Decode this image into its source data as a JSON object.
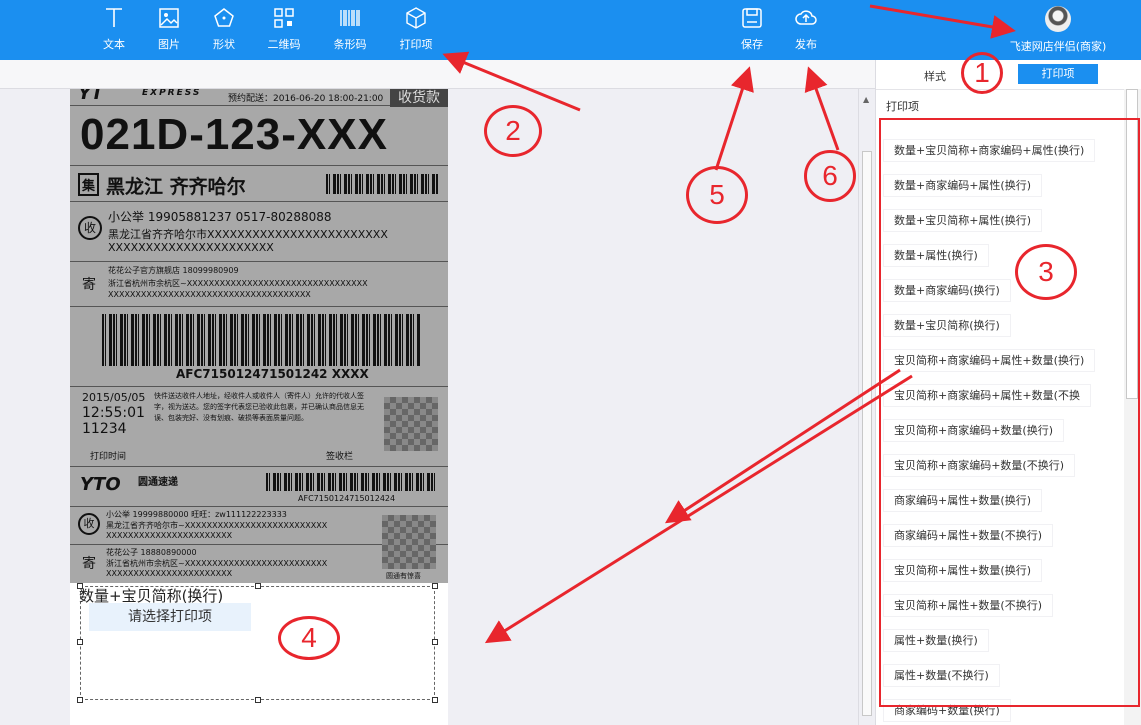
{
  "toolbar": {
    "tools": [
      "文本",
      "图片",
      "形状",
      "二维码",
      "条形码",
      "打印项"
    ],
    "save": "保存",
    "publish": "发布",
    "user_name": "飞速网店伴侣(商家)"
  },
  "right_panel": {
    "tab_style": "样式",
    "tab_print": "打印项",
    "section_title": "打印项",
    "items": [
      "数量+宝贝简称+商家编码+属性(换行)",
      "数量+商家编码+属性(换行)",
      "数量+宝贝简称+属性(换行)",
      "数量+属性(换行)",
      "数量+商家编码(换行)",
      "数量+宝贝简称(换行)",
      "宝贝简称+商家编码+属性+数量(换行)",
      "宝贝简称+商家编码+属性+数量(不换",
      "宝贝简称+商家编码+数量(换行)",
      "宝贝简称+商家编码+数量(不换行)",
      "商家编码+属性+数量(换行)",
      "商家编码+属性+数量(不换行)",
      "宝贝简称+属性+数量(换行)",
      "宝贝简称+属性+数量(不换行)",
      "属性+数量(换行)",
      "属性+数量(不换行)",
      "商家编码+数量(换行)"
    ]
  },
  "label": {
    "express_en": "EXPRESS",
    "schedule": "预约配送：2016-06-20 18:00-21:00",
    "receipt_tag": "收货款",
    "big_code": "021D-123-XXX",
    "ji": "集",
    "region": "黑龙江 齐齐哈尔",
    "shou": "收",
    "receiver_line": "小公举   19905881237   0517-80288088",
    "receiver_addr1": "黑龙江省齐齐哈尔市XXXXXXXXXXXXXXXXXXXXXXXX",
    "receiver_addr2": "XXXXXXXXXXXXXXXXXXXXXX",
    "ji2": "寄",
    "sender_line": "花花公子官方旗舰店   18099980909",
    "sender_addr1": "浙江省杭州市余杭区~XXXXXXXXXXXXXXXXXXXXXXXXXXXXXXXXX",
    "sender_addr2": "XXXXXXXXXXXXXXXXXXXXXXXXXXXXXXXXXXXXX",
    "barcode_text": "AFC715012471501242 XXXX",
    "date": "2015/05/05",
    "time": "12:55:01",
    "num": "11234",
    "notice": "快件送达收件人地址，经收件人或收件人（寄件人）允许的代收人签字，视为送达。您的签字代表您已验收此包裹，并已确认商品信息无误、包装完好、没有划痕、破损等表面质量问题。",
    "print_time": "打印时间",
    "sign": "签收栏",
    "yto_cn": "圆通速递",
    "barcode2_text": "AFC7150124715012424",
    "r2_line": "小公举   19999880000   旺旺：zw111122223333",
    "r2_addr1": "黑龙江省齐齐哈尔市~XXXXXXXXXXXXXXXXXXXXXXXXXX",
    "r2_addr2": "XXXXXXXXXXXXXXXXXXXXXXX",
    "s2_line": "花花公子   18880890000",
    "s2_addr1": "浙江省杭州市余杭区~XXXXXXXXXXXXXXXXXXXXXXXXXX",
    "s2_addr2": "XXXXXXXXXXXXXXXXXXXXXXX",
    "qr_caption": "圆通有惊喜",
    "field_text": "数量+宝贝简称(换行)",
    "field_hint": "请选择打印项"
  },
  "annotations": [
    "1",
    "2",
    "3",
    "4",
    "5",
    "6"
  ],
  "colors": {
    "topbar": "#1b8ff0",
    "accent": "#e8262d",
    "tab_active": "#1b8ff0"
  }
}
